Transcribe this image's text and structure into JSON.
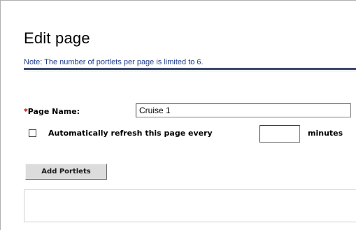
{
  "page": {
    "title": "Edit page",
    "note": "Note: The number of portlets per page is limited to 6."
  },
  "form": {
    "page_name": {
      "required_marker": "*",
      "label": "Page Name:",
      "value": "Cruise 1"
    },
    "auto_refresh": {
      "checked": false,
      "label": "Automatically refresh this page every",
      "minutes_value": "",
      "unit_label": "minutes"
    },
    "add_portlets_label": "Add Portlets"
  },
  "colors": {
    "note_text": "#1f3d8a",
    "rule": "#3b4a6b",
    "required": "#cc0000",
    "button_bg": "#dcdcdc"
  }
}
